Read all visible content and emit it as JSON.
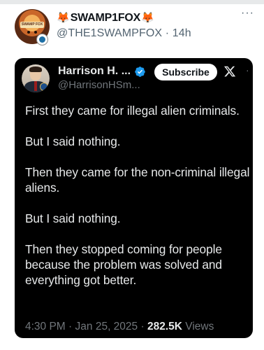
{
  "post": {
    "display_name": "SWAMP1FOX",
    "name_emoji_left": "🦊",
    "name_emoji_right": "🦊",
    "handle": "@THE1SWAMPFOX",
    "separator": "·",
    "time_ago": "14h",
    "more_glyph": "···",
    "avatar_banner_text": "SWAMP FOX"
  },
  "embedded_tweet": {
    "display_name": "Harrison H. ...",
    "handle": "@HarrisonHSm...",
    "subscribe_label": "Subscribe",
    "more_glyph": "·",
    "paragraphs": [
      "First they came for illegal alien criminals.",
      "But I said nothing.",
      "Then they came for the non-criminal illegal aliens.",
      "But I said nothing.",
      "Then they stopped coming for people because the problem was solved and everything got better."
    ],
    "time": "4:30 PM",
    "meta_separator": "·",
    "date": "Jan 25, 2025",
    "views_count": "282.5K",
    "views_label": "Views"
  },
  "colors": {
    "verified_blue": "#1d9bf0",
    "card_background": "#000000",
    "secondary_text": "#536471"
  },
  "icons": [
    "fox-emoji",
    "more-icon",
    "verified-icon",
    "x-logo-icon",
    "badge-icon"
  ]
}
